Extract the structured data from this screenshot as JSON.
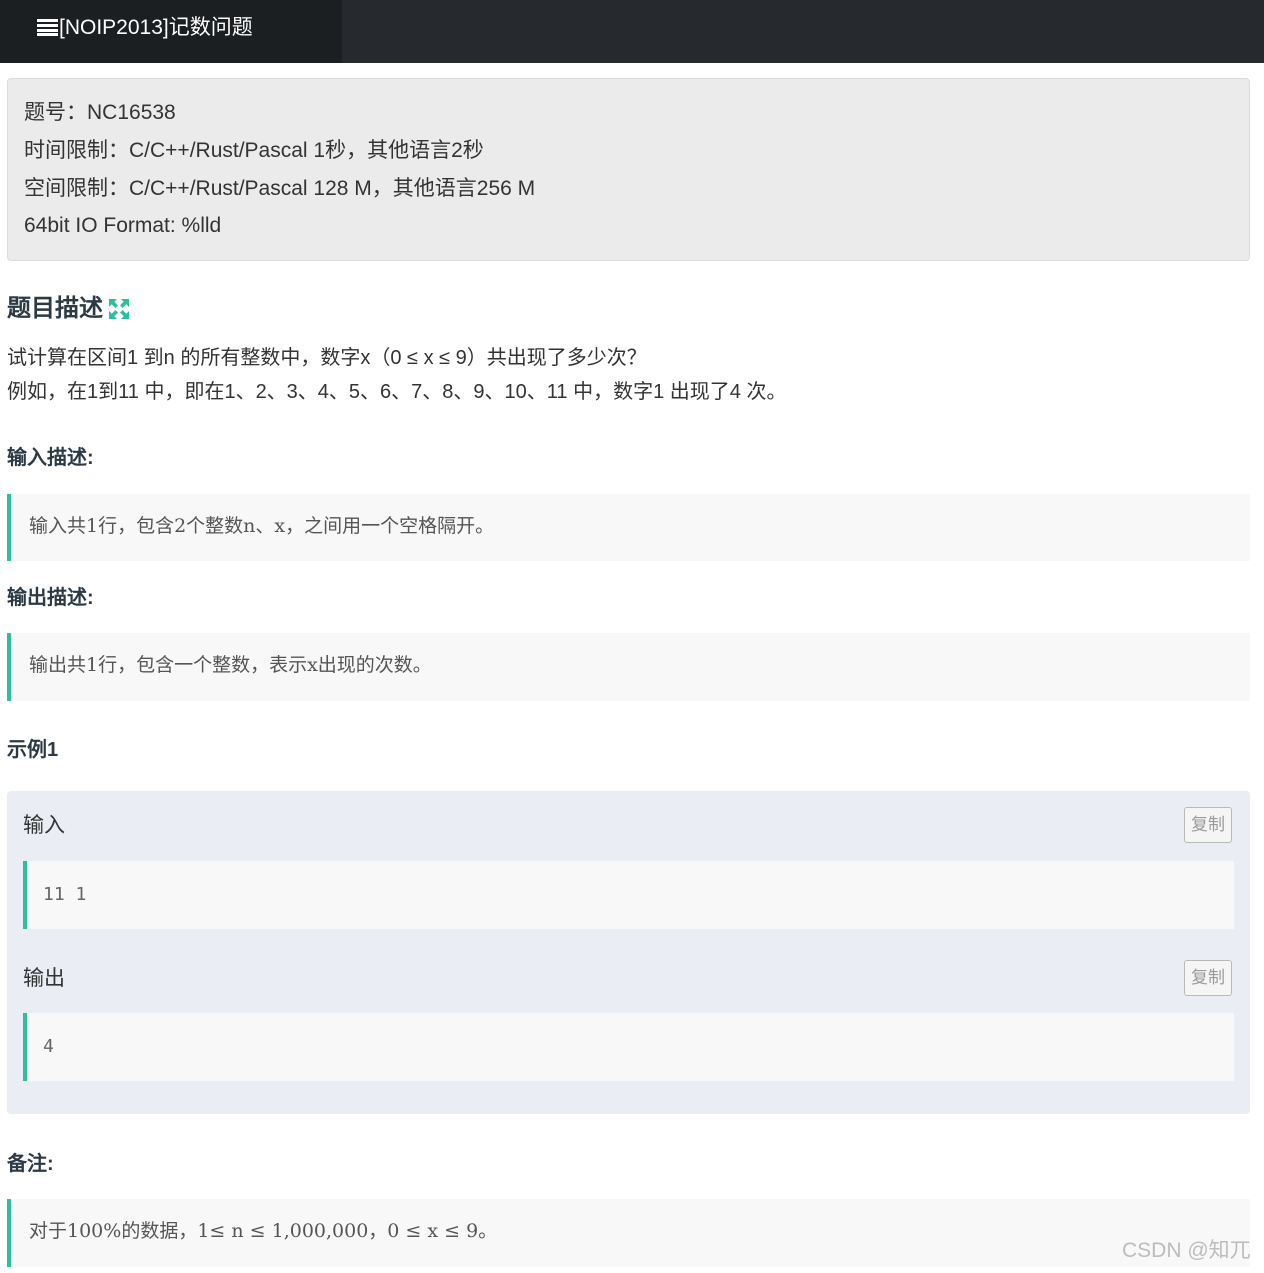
{
  "header": {
    "title": "[NOIP2013]记数问题",
    "icon": "list-icon"
  },
  "info": {
    "problem_id": "题号：NC16538",
    "time_limit": "时间限制：C/C++/Rust/Pascal 1秒，其他语言2秒",
    "memory_limit": "空间限制：C/C++/Rust/Pascal 128 M，其他语言256 M",
    "io_format": "64bit IO Format: %lld"
  },
  "description": {
    "title": "题目描述",
    "expand_icon": "expand-icon",
    "expand_icon_color": "#2bbf9b",
    "line1": "试计算在区间1 到n 的所有整数中，数字x（0 ≤ x ≤ 9）共出现了多少次？",
    "line2": "例如，在1到11 中，即在1、2、3、4、5、6、7、8、9、10、11 中，数字1 出现了4 次。"
  },
  "input_desc": {
    "title": "输入描述:",
    "text": "输入共1行，包含2个整数n、x，之间用一个空格隔开。"
  },
  "output_desc": {
    "title": "输出描述:",
    "text": "输出共1行，包含一个整数，表示x出现的次数。"
  },
  "sample": {
    "title": "示例1",
    "input_label": "输入",
    "input_value": "11 1",
    "output_label": "输出",
    "output_value": "4",
    "copy_label": "复制"
  },
  "note": {
    "title": "备注:",
    "text": "对于100%的数据，1≤ n ≤ 1,000,000，0 ≤ x ≤ 9。"
  },
  "watermark": "CSDN @知兀",
  "colors": {
    "accent": "#2bbf9b",
    "topbar": "#262a2e",
    "title_tab": "#1c1f22"
  }
}
